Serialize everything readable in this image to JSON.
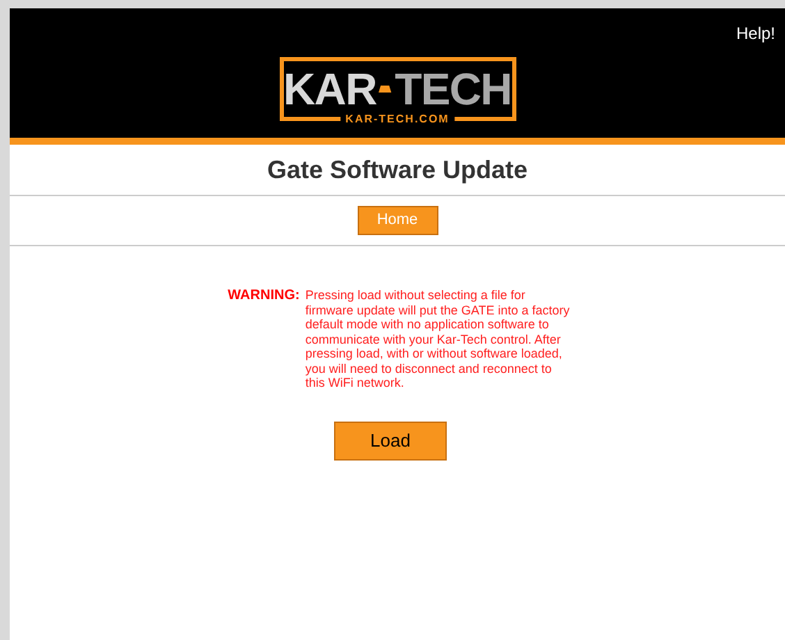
{
  "header": {
    "help_link": "Help!",
    "logo": {
      "left": "KAR",
      "right": "TECH",
      "url": "KAR-TECH.COM"
    }
  },
  "title": "Gate Software Update",
  "nav": {
    "home_button": "Home"
  },
  "warning": {
    "label": "WARNING:",
    "message": "Pressing load without selecting a file for firmware update will put the GATE into a factory default mode with no application software to communicate with your Kar-Tech control.  After pressing load, with or without software loaded, you will need to disconnect and reconnect to this WiFi network."
  },
  "load_button": "Load"
}
